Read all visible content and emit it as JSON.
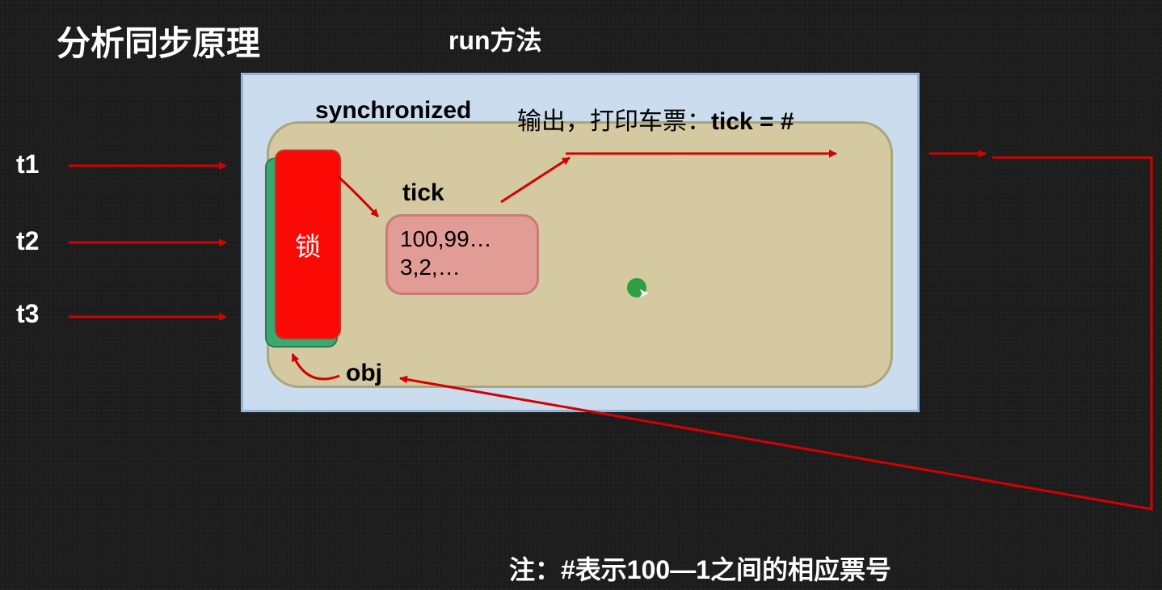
{
  "title": "分析同步原理",
  "run_method_label": "run方法",
  "synchronized_label": "synchronized",
  "lock_label": "锁",
  "tick_label": "tick",
  "tick_values_line1": "100,99…",
  "tick_values_line2": "3,2,…",
  "obj_label": "obj",
  "output_prefix": "输出，打印车票：",
  "output_bold": "tick = #",
  "threads": {
    "t1": "t1",
    "t2": "t2",
    "t3": "t3"
  },
  "note": "注：#表示100—1之间的相应票号"
}
